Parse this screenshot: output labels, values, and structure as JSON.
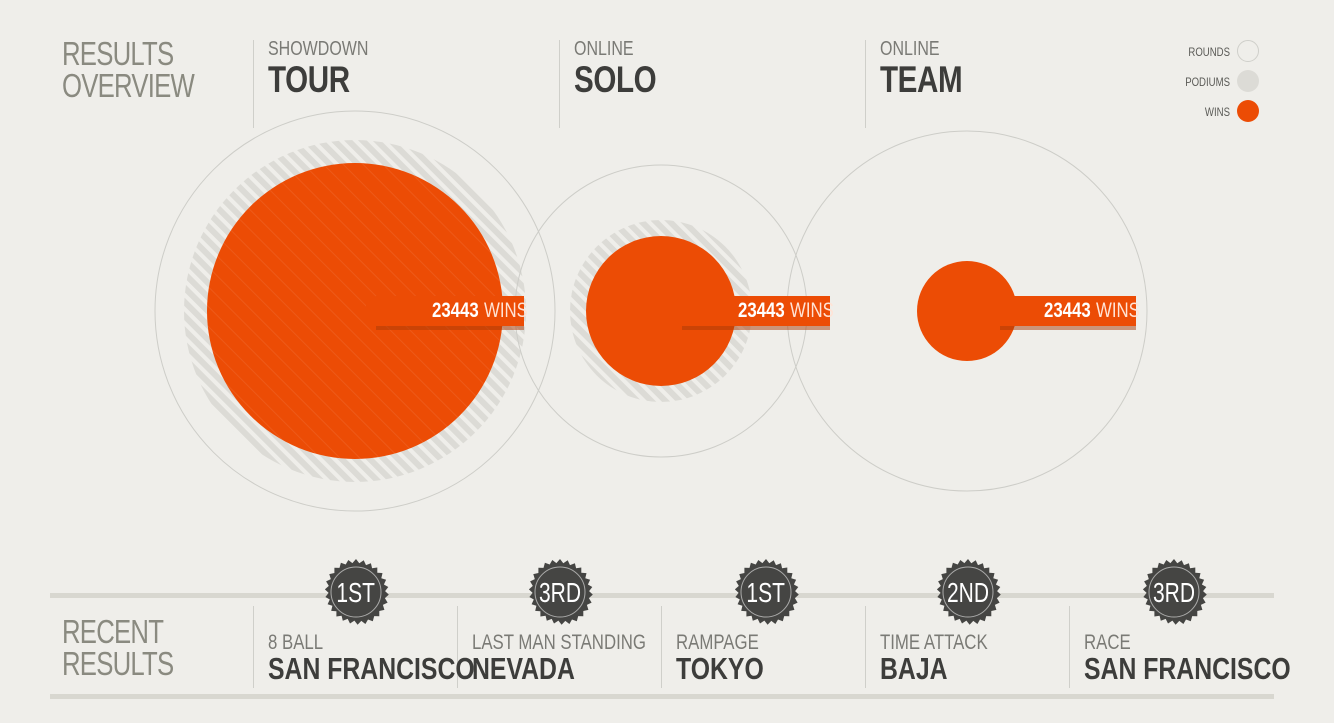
{
  "overview": {
    "title_line1": "RESULTS",
    "title_line2": "OVERVIEW",
    "modes": [
      {
        "sub": "SHOWDOWN",
        "main": "TOUR",
        "wins_value": "23443",
        "wins_unit": "WINS"
      },
      {
        "sub": "ONLINE",
        "main": "SOLO",
        "wins_value": "23443",
        "wins_unit": "WINS"
      },
      {
        "sub": "ONLINE",
        "main": "TEAM",
        "wins_value": "23443",
        "wins_unit": "WINS"
      }
    ]
  },
  "legend": {
    "rounds": "ROUNDS",
    "podiums": "PODIUMS",
    "wins": "WINS"
  },
  "colors": {
    "accent": "#ec4c05",
    "podium": "#dcdbd6",
    "ring": "#cdcdc8",
    "badge": "#454543"
  },
  "recent": {
    "title_line1": "RECENT",
    "title_line2": "RESULTS",
    "items": [
      {
        "place": "1ST",
        "sub": "8 BALL",
        "main": "SAN FRANCISCO"
      },
      {
        "place": "3RD",
        "sub": "LAST MAN STANDING",
        "main": "NEVADA"
      },
      {
        "place": "1ST",
        "sub": "RAMPAGE",
        "main": "TOKYO"
      },
      {
        "place": "2ND",
        "sub": "TIME ATTACK",
        "main": "BAJA"
      },
      {
        "place": "3RD",
        "sub": "RACE",
        "main": "SAN FRANCISCO"
      }
    ]
  }
}
